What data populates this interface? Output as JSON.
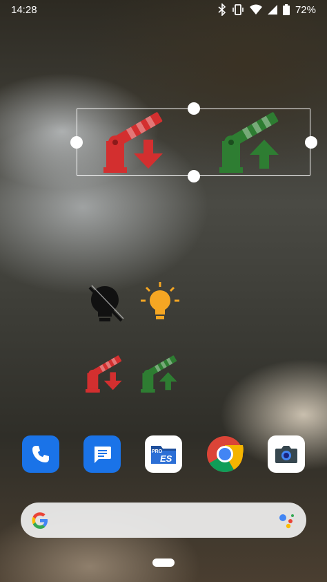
{
  "status_bar": {
    "time": "14:28",
    "battery_percent": "72%",
    "icons": [
      "bluetooth-icon",
      "vibrate-icon",
      "wifi-icon",
      "signal-icon",
      "battery-icon"
    ]
  },
  "widgets": {
    "selected_widget": {
      "icons": [
        "gate-close-red-icon",
        "gate-open-green-icon"
      ],
      "colors": {
        "close": "#d32f2f",
        "open": "#2e7d32"
      }
    },
    "light_toggles": {
      "icons": [
        "light-off-icon",
        "light-on-icon"
      ],
      "colors": {
        "off": "#000000",
        "on": "#f5a623"
      }
    },
    "gate_shortcuts": {
      "icons": [
        "gate-close-red-icon",
        "gate-open-green-icon"
      ]
    }
  },
  "dock": {
    "apps": [
      {
        "name": "phone-app",
        "icon": "phone-icon",
        "color": "#1a73e8"
      },
      {
        "name": "messages-app",
        "icon": "messages-icon",
        "color": "#1a73e8"
      },
      {
        "name": "es-file-explorer-app",
        "icon": "es-file-explorer-icon",
        "label": "ES",
        "badge": "PRO"
      },
      {
        "name": "chrome-app",
        "icon": "chrome-icon"
      },
      {
        "name": "camera-app",
        "icon": "camera-icon"
      }
    ]
  },
  "search": {
    "icons": [
      "google-g-icon",
      "google-assistant-icon"
    ]
  }
}
